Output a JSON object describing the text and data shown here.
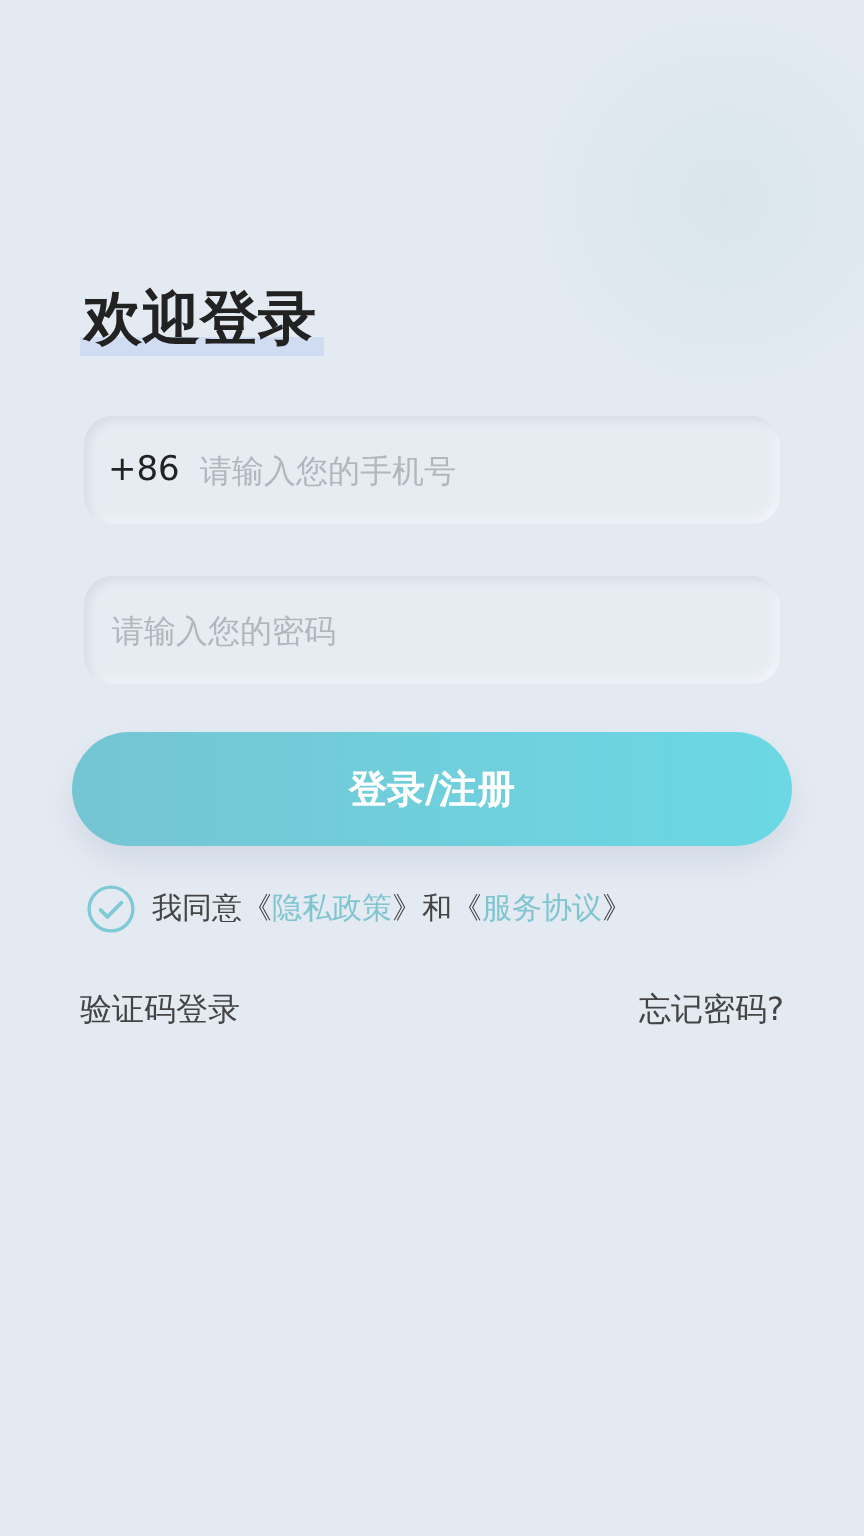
{
  "title": "欢迎登录",
  "phone_field": {
    "prefix": "+86",
    "placeholder": "请输入您的手机号"
  },
  "password_field": {
    "placeholder": "请输入您的密码"
  },
  "login_button": "登录/注册",
  "agreement": {
    "checked": true,
    "parts": [
      {
        "kind": "text",
        "text": "我同意《"
      },
      {
        "kind": "link",
        "text": "隐私政策"
      },
      {
        "kind": "text",
        "text": "》和《"
      },
      {
        "kind": "link",
        "text": "服务协议"
      },
      {
        "kind": "text",
        "text": "》"
      }
    ]
  },
  "sms_login_link": "验证码登录",
  "forgot_password_link": "忘记密码?"
}
